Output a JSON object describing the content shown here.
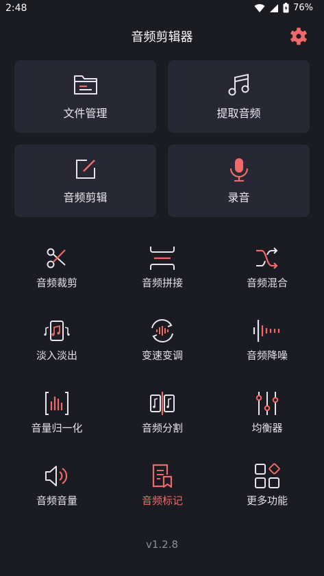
{
  "status": {
    "time": "2:48",
    "battery": "76%"
  },
  "header": {
    "title": "音频剪辑器"
  },
  "colors": {
    "accent": "#f06a6a",
    "background": "#1b1b22",
    "card": "#272833",
    "icon": "#e6e6ec"
  },
  "cards": [
    {
      "label": "文件管理",
      "icon": "folder-icon"
    },
    {
      "label": "提取音频",
      "icon": "music-note-icon"
    },
    {
      "label": "音频剪辑",
      "icon": "edit-icon"
    },
    {
      "label": "录音",
      "icon": "microphone-icon"
    }
  ],
  "tools": [
    {
      "label": "音频裁剪",
      "icon": "scissors-icon"
    },
    {
      "label": "音频拼接",
      "icon": "join-icon"
    },
    {
      "label": "音频混合",
      "icon": "shuffle-icon"
    },
    {
      "label": "淡入淡出",
      "icon": "fade-icon"
    },
    {
      "label": "变速变调",
      "icon": "speed-icon"
    },
    {
      "label": "音频降噪",
      "icon": "denoise-icon"
    },
    {
      "label": "音量归一化",
      "icon": "normalize-icon"
    },
    {
      "label": "音频分割",
      "icon": "split-icon"
    },
    {
      "label": "均衡器",
      "icon": "equalizer-icon"
    },
    {
      "label": "音频音量",
      "icon": "volume-icon"
    },
    {
      "label": "音频标记",
      "icon": "mark-icon"
    },
    {
      "label": "更多功能",
      "icon": "more-apps-icon"
    }
  ],
  "footer": {
    "version": "v1.2.8"
  }
}
